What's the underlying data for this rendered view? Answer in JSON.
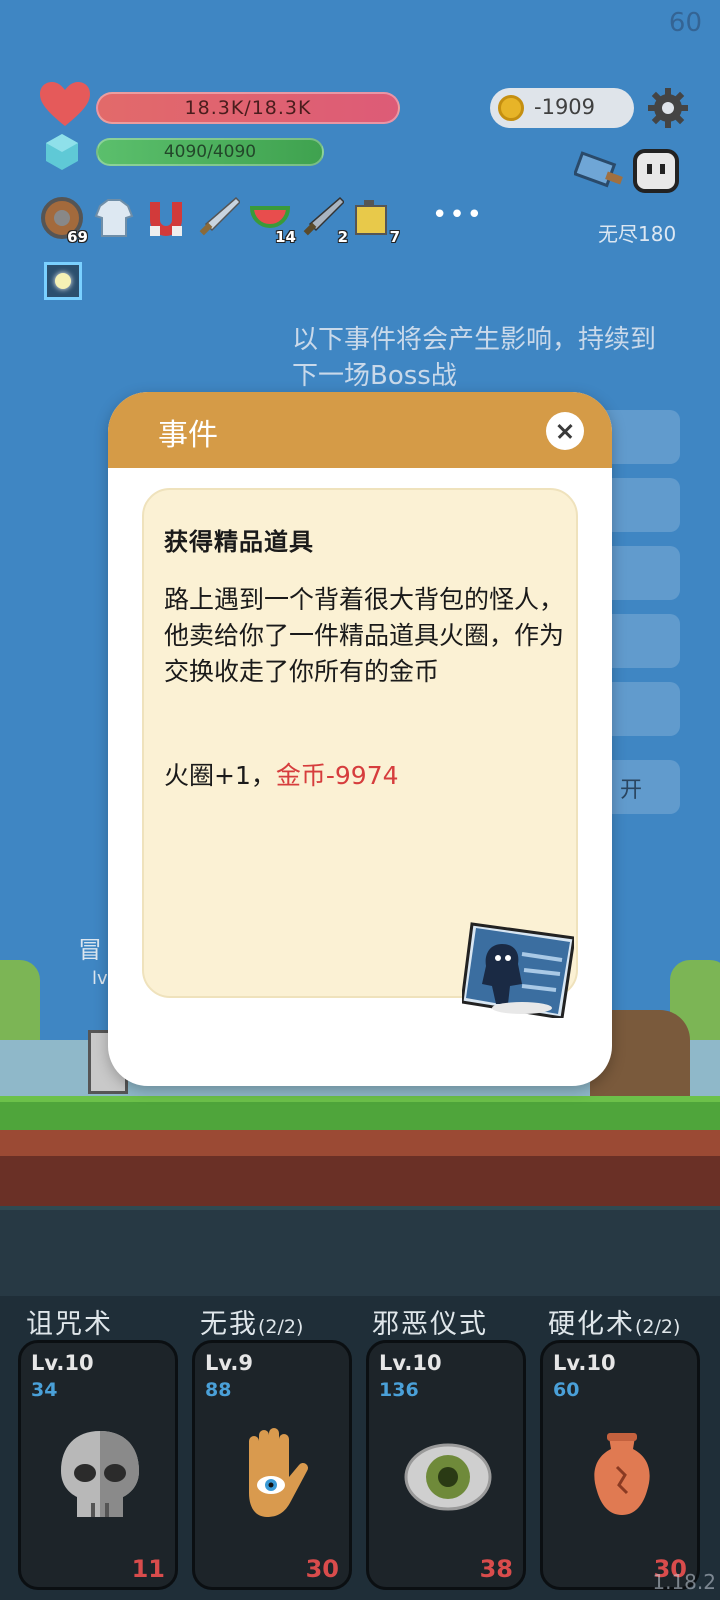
{
  "fps": "60",
  "hud": {
    "hp": "18.3K/18.3K",
    "mp": "4090/4090",
    "gold": "-1909",
    "mode": "无尽180"
  },
  "items": [
    {
      "name": "shield-icon",
      "count": "69"
    },
    {
      "name": "shirt-icon",
      "count": ""
    },
    {
      "name": "magnet-icon",
      "count": ""
    },
    {
      "name": "sword-icon",
      "count": ""
    },
    {
      "name": "watermelon-icon",
      "count": "14"
    },
    {
      "name": "sword-2-icon",
      "count": "2"
    },
    {
      "name": "battery-icon",
      "count": "7"
    }
  ],
  "more": "•••",
  "notice": "以下事件将会产生影响，持续到下一场Boss战",
  "side": {
    "open_partial": "开"
  },
  "npc": {
    "label": "冒",
    "sub": "lv"
  },
  "modal": {
    "title": "事件",
    "event_title": "获得精品道具",
    "event_text": "路上遇到一个背着很大背包的怪人，他卖给你了一件精品道具火圈，作为交换收走了你所有的金币",
    "result_gain": "火圈+1，",
    "result_loss": "金币-9974"
  },
  "skills": [
    {
      "title": "诅咒术",
      "suffix": "",
      "lv": "Lv.10",
      "num": "34",
      "cost": "11",
      "icon": "skull-icon"
    },
    {
      "title": "无我",
      "suffix": "(2/2)",
      "lv": "Lv.9",
      "num": "88",
      "cost": "30",
      "icon": "hand-eye-icon"
    },
    {
      "title": "邪恶仪式",
      "suffix": "",
      "lv": "Lv.10",
      "num": "136",
      "cost": "38",
      "icon": "eye-icon"
    },
    {
      "title": "硬化术",
      "suffix": "(2/2)",
      "lv": "Lv.10",
      "num": "60",
      "cost": "30",
      "icon": "vase-icon"
    }
  ],
  "version": "1.18.2",
  "colors": {
    "header": "#d59b47",
    "negative": "#d63d3d",
    "sky": "#3f86c3"
  }
}
